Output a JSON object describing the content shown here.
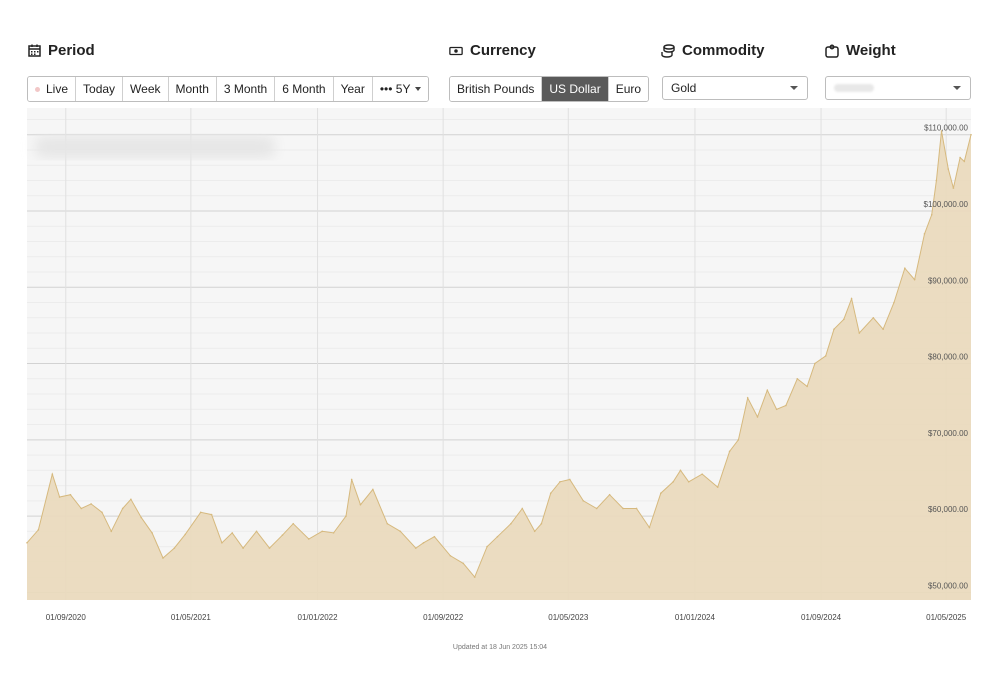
{
  "sections": {
    "period": "Period",
    "currency": "Currency",
    "commodity": "Commodity",
    "weight": "Weight"
  },
  "period_buttons": [
    "Live",
    "Today",
    "Week",
    "Month",
    "3 Month",
    "6 Month",
    "Year",
    "••• 5Y"
  ],
  "currency_buttons": [
    "British Pounds",
    "US Dollar",
    "Euro"
  ],
  "currency_selected": "US Dollar",
  "commodity_select": "Gold",
  "weight_select": "",
  "updated": "Updated at 18 Jun 2025 15:04",
  "colors": {
    "area_fill": "#ead9bb",
    "area_line": "#d6b97e",
    "active_button": "#5a5a5a",
    "plot_bg": "#f6f6f6"
  },
  "chart_data": {
    "type": "area",
    "title": "",
    "xlabel": "",
    "ylabel": "",
    "x_tick_labels": [
      "01/09/2020",
      "01/05/2021",
      "01/01/2022",
      "01/09/2022",
      "01/05/2023",
      "01/01/2024",
      "01/09/2024",
      "01/05/2025"
    ],
    "y_tick_values": [
      50000,
      60000,
      70000,
      80000,
      90000,
      100000,
      110000
    ],
    "y_tick_labels": [
      "$50,000.00",
      "$60,000.00",
      "$70,000.00",
      "$80,000.00",
      "$90,000.00",
      "$100,000.00",
      "$110,000.00"
    ],
    "ylim": [
      49000,
      113500
    ],
    "xlim": [
      "2020-06-18",
      "2025-06-18"
    ],
    "grid": true,
    "series": [
      {
        "values": [
          {
            "x": "2020-06-18",
            "y": 56500
          },
          {
            "x": "2020-07-10",
            "y": 58200
          },
          {
            "x": "2020-08-06",
            "y": 65500
          },
          {
            "x": "2020-08-20",
            "y": 62500
          },
          {
            "x": "2020-09-10",
            "y": 62800
          },
          {
            "x": "2020-10-01",
            "y": 61000
          },
          {
            "x": "2020-10-20",
            "y": 61600
          },
          {
            "x": "2020-11-10",
            "y": 60500
          },
          {
            "x": "2020-11-28",
            "y": 58000
          },
          {
            "x": "2020-12-20",
            "y": 61000
          },
          {
            "x": "2021-01-05",
            "y": 62200
          },
          {
            "x": "2021-01-25",
            "y": 59800
          },
          {
            "x": "2021-02-15",
            "y": 57800
          },
          {
            "x": "2021-03-08",
            "y": 54500
          },
          {
            "x": "2021-03-30",
            "y": 55800
          },
          {
            "x": "2021-04-20",
            "y": 57600
          },
          {
            "x": "2021-05-20",
            "y": 60500
          },
          {
            "x": "2021-06-10",
            "y": 60200
          },
          {
            "x": "2021-06-30",
            "y": 56500
          },
          {
            "x": "2021-07-20",
            "y": 57800
          },
          {
            "x": "2021-08-10",
            "y": 55800
          },
          {
            "x": "2021-09-05",
            "y": 58000
          },
          {
            "x": "2021-09-30",
            "y": 55800
          },
          {
            "x": "2021-10-25",
            "y": 57500
          },
          {
            "x": "2021-11-15",
            "y": 59000
          },
          {
            "x": "2021-12-15",
            "y": 57000
          },
          {
            "x": "2022-01-10",
            "y": 58000
          },
          {
            "x": "2022-02-01",
            "y": 57800
          },
          {
            "x": "2022-02-25",
            "y": 60000
          },
          {
            "x": "2022-03-08",
            "y": 64800
          },
          {
            "x": "2022-03-25",
            "y": 61500
          },
          {
            "x": "2022-04-18",
            "y": 63500
          },
          {
            "x": "2022-05-16",
            "y": 59000
          },
          {
            "x": "2022-06-10",
            "y": 58000
          },
          {
            "x": "2022-07-10",
            "y": 55800
          },
          {
            "x": "2022-07-25",
            "y": 56500
          },
          {
            "x": "2022-08-15",
            "y": 57300
          },
          {
            "x": "2022-09-15",
            "y": 54800
          },
          {
            "x": "2022-10-10",
            "y": 53800
          },
          {
            "x": "2022-11-01",
            "y": 52000
          },
          {
            "x": "2022-11-25",
            "y": 56000
          },
          {
            "x": "2022-12-15",
            "y": 57300
          },
          {
            "x": "2023-01-10",
            "y": 59000
          },
          {
            "x": "2023-02-01",
            "y": 61000
          },
          {
            "x": "2023-02-25",
            "y": 58000
          },
          {
            "x": "2023-03-10",
            "y": 59000
          },
          {
            "x": "2023-03-28",
            "y": 63000
          },
          {
            "x": "2023-04-15",
            "y": 64500
          },
          {
            "x": "2023-05-04",
            "y": 64800
          },
          {
            "x": "2023-05-30",
            "y": 62000
          },
          {
            "x": "2023-06-25",
            "y": 61000
          },
          {
            "x": "2023-07-20",
            "y": 62800
          },
          {
            "x": "2023-08-15",
            "y": 61000
          },
          {
            "x": "2023-09-10",
            "y": 61000
          },
          {
            "x": "2023-10-05",
            "y": 58500
          },
          {
            "x": "2023-10-27",
            "y": 63000
          },
          {
            "x": "2023-11-20",
            "y": 64500
          },
          {
            "x": "2023-12-04",
            "y": 66000
          },
          {
            "x": "2023-12-20",
            "y": 64500
          },
          {
            "x": "2024-01-15",
            "y": 65500
          },
          {
            "x": "2024-02-14",
            "y": 63800
          },
          {
            "x": "2024-03-08",
            "y": 68500
          },
          {
            "x": "2024-03-25",
            "y": 70000
          },
          {
            "x": "2024-04-12",
            "y": 75500
          },
          {
            "x": "2024-05-01",
            "y": 73000
          },
          {
            "x": "2024-05-20",
            "y": 76500
          },
          {
            "x": "2024-06-07",
            "y": 74000
          },
          {
            "x": "2024-06-25",
            "y": 74500
          },
          {
            "x": "2024-07-17",
            "y": 78000
          },
          {
            "x": "2024-08-05",
            "y": 77000
          },
          {
            "x": "2024-08-20",
            "y": 80000
          },
          {
            "x": "2024-09-10",
            "y": 81000
          },
          {
            "x": "2024-09-26",
            "y": 84500
          },
          {
            "x": "2024-10-15",
            "y": 85800
          },
          {
            "x": "2024-10-30",
            "y": 88500
          },
          {
            "x": "2024-11-14",
            "y": 84000
          },
          {
            "x": "2024-12-11",
            "y": 86000
          },
          {
            "x": "2024-12-30",
            "y": 84500
          },
          {
            "x": "2025-01-20",
            "y": 88000
          },
          {
            "x": "2025-02-10",
            "y": 92500
          },
          {
            "x": "2025-03-01",
            "y": 91000
          },
          {
            "x": "2025-03-20",
            "y": 97000
          },
          {
            "x": "2025-04-03",
            "y": 99500
          },
          {
            "x": "2025-04-12",
            "y": 104000
          },
          {
            "x": "2025-04-22",
            "y": 110500
          },
          {
            "x": "2025-05-05",
            "y": 105500
          },
          {
            "x": "2025-05-15",
            "y": 103000
          },
          {
            "x": "2025-05-28",
            "y": 107000
          },
          {
            "x": "2025-06-05",
            "y": 106500
          },
          {
            "x": "2025-06-18",
            "y": 110000
          }
        ]
      }
    ]
  }
}
